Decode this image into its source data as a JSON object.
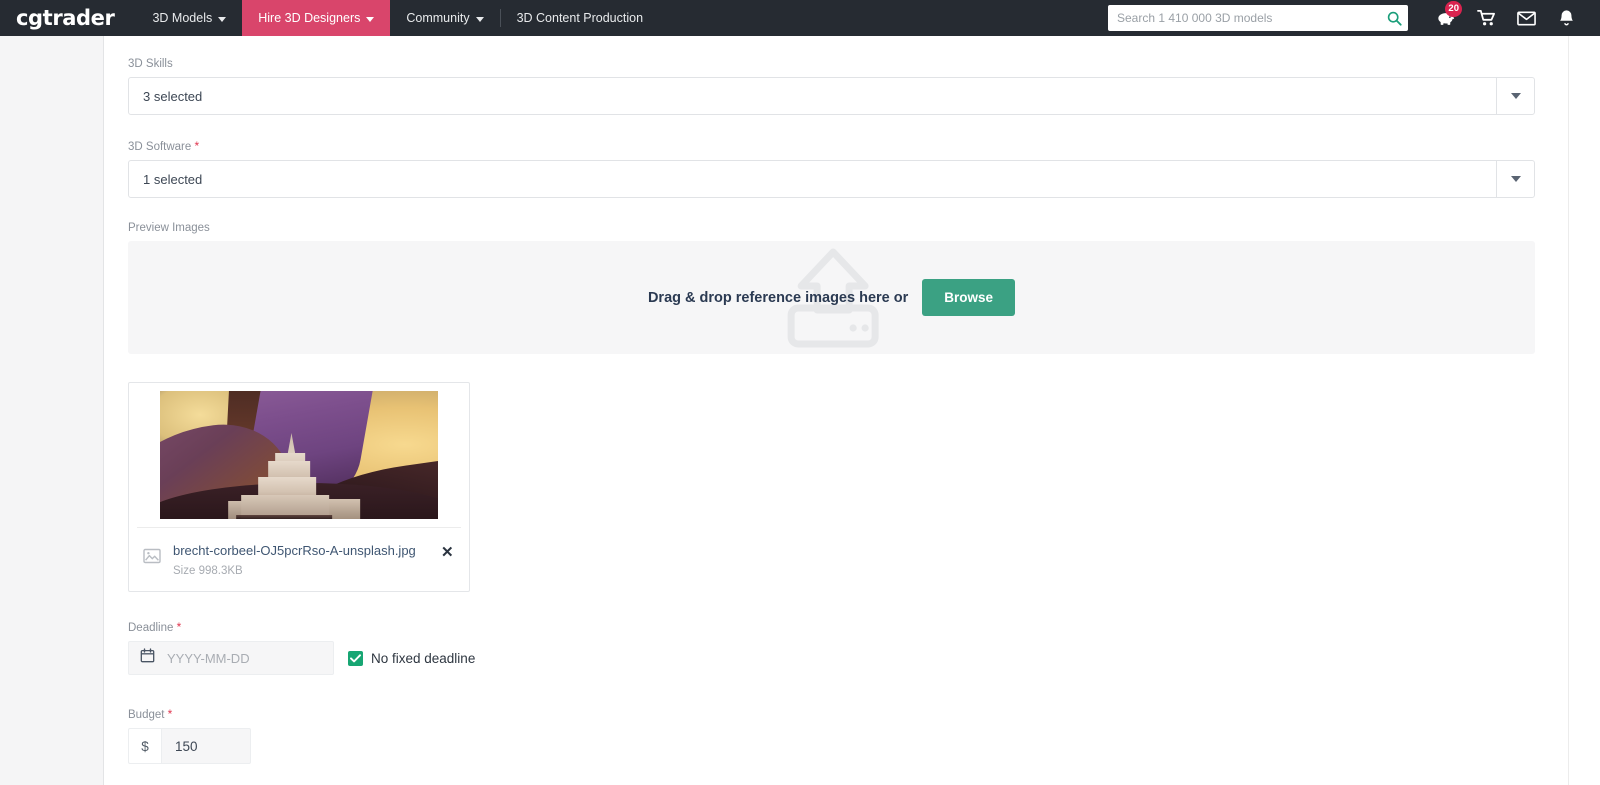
{
  "header": {
    "brand": "cgtrader",
    "nav": [
      {
        "label": "3D Models",
        "has_caret": true,
        "active": false
      },
      {
        "label": "Hire 3D Designers",
        "has_caret": true,
        "active": true
      },
      {
        "label": "Community",
        "has_caret": true,
        "active": false
      },
      {
        "label": "3D Content Production",
        "has_caret": false,
        "active": false
      }
    ],
    "search": {
      "placeholder": "Search 1 410 000 3D models",
      "value": ""
    },
    "icons": {
      "search": "search-icon",
      "piggy": "piggy-bank-icon",
      "piggy_badge": "20",
      "cart": "cart-icon",
      "mail": "envelope-icon",
      "bell": "bell-icon"
    }
  },
  "form": {
    "skills": {
      "label": "3D Skills",
      "required": false,
      "value": "3 selected"
    },
    "software": {
      "label": "3D Software",
      "required": true,
      "required_mark": "*",
      "value": "1 selected"
    },
    "preview_images": {
      "label": "Preview Images",
      "dropzone_text": "Drag & drop reference images here or",
      "browse_label": "Browse"
    },
    "uploaded_file": {
      "name": "brecht-corbeel-OJ5pcrRso-A-unsplash.jpg",
      "size": "Size 998.3KB",
      "remove_label": "✕"
    },
    "deadline": {
      "label": "Deadline",
      "required_mark": "*",
      "placeholder": "YYYY-MM-DD",
      "value": "",
      "no_fixed_deadline_label": "No fixed deadline",
      "no_fixed_deadline_checked": true
    },
    "budget": {
      "label": "Budget",
      "required_mark": "*",
      "currency": "$",
      "value": "150"
    }
  },
  "colors": {
    "nav_bg": "#262b32",
    "nav_active": "#d9456b",
    "accent_green": "#3ba183",
    "checkbox_green": "#17a673",
    "badge_red": "#d9234f",
    "required_red": "#e0364f"
  }
}
